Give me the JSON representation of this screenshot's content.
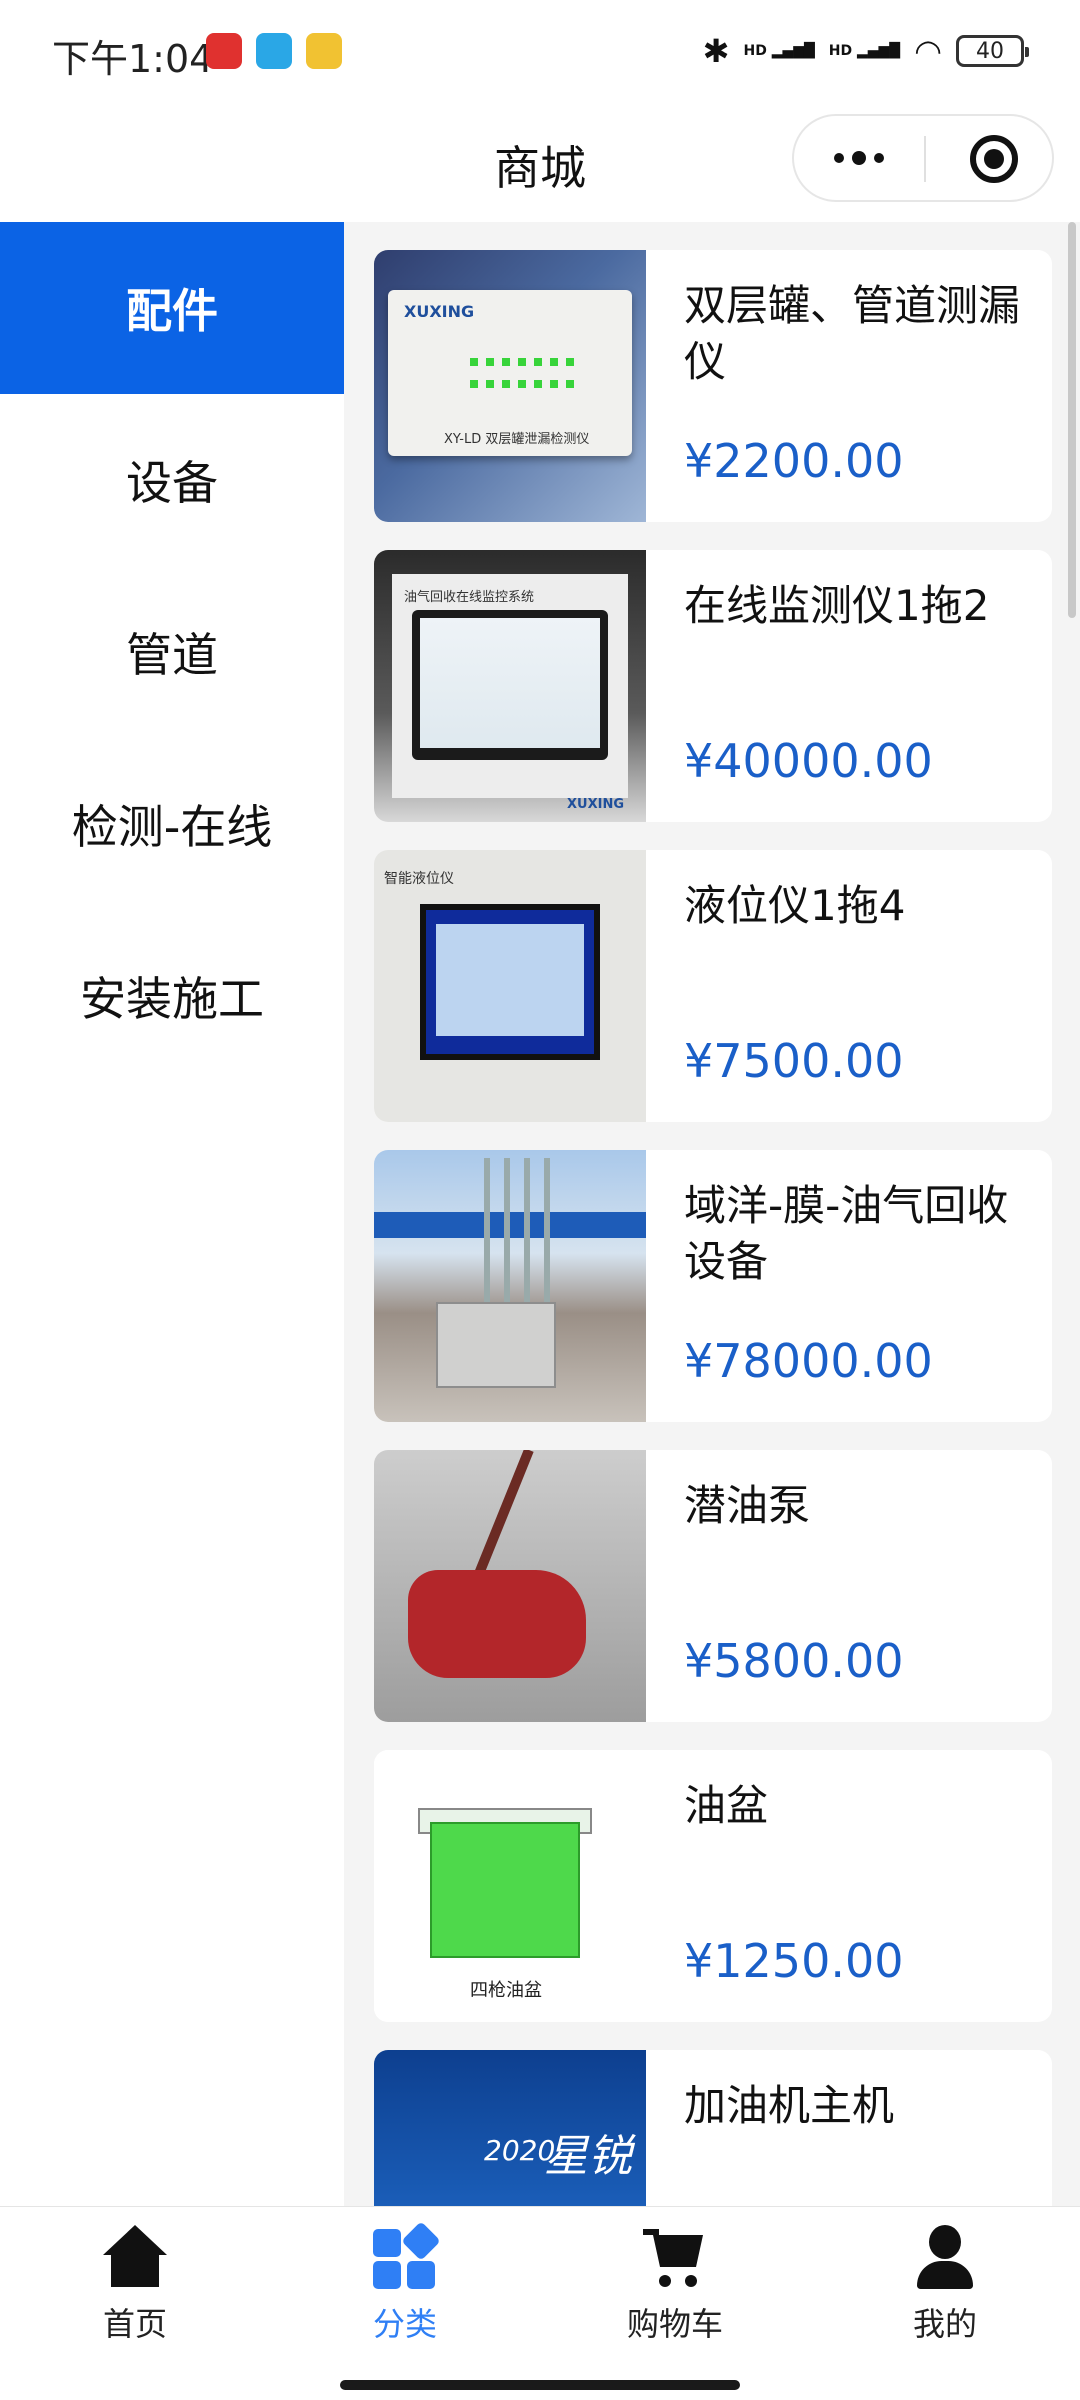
{
  "status_bar": {
    "time": "下午1:04",
    "battery": "40",
    "network_labels": [
      "HD",
      "HD"
    ]
  },
  "header": {
    "title": "商城"
  },
  "sidebar": {
    "items": [
      {
        "label": "配件",
        "active": true
      },
      {
        "label": "设备",
        "active": false
      },
      {
        "label": "管道",
        "active": false
      },
      {
        "label": "检测-在线",
        "active": false
      },
      {
        "label": "安装施工",
        "active": false
      }
    ]
  },
  "products": [
    {
      "name": "双层罐、管道测漏仪",
      "price": "¥2200.00",
      "image_text": [
        "XUXING",
        "XY-LD 双层罐泄漏检测仪"
      ]
    },
    {
      "name": "在线监测仪1拖2",
      "price": "¥40000.00",
      "image_text": [
        "油气回收在线监控系统",
        "XUXING"
      ]
    },
    {
      "name": "液位仪1拖4",
      "price": "¥7500.00",
      "image_text": [
        "智能液位仪"
      ]
    },
    {
      "name": "域洋-膜-油气回收设备",
      "price": "¥78000.00"
    },
    {
      "name": "潜油泵",
      "price": "¥5800.00"
    },
    {
      "name": "油盆",
      "price": "¥1250.00",
      "image_text": [
        "四枪油盆"
      ]
    },
    {
      "name": "加油机主机",
      "price": "",
      "image_text": [
        "2020",
        "星锐"
      ]
    }
  ],
  "tabbar": {
    "tabs": [
      {
        "label": "首页",
        "icon": "home-icon",
        "active": false
      },
      {
        "label": "分类",
        "icon": "category-icon",
        "active": true
      },
      {
        "label": "购物车",
        "icon": "cart-icon",
        "active": false
      },
      {
        "label": "我的",
        "icon": "user-icon",
        "active": false
      }
    ]
  },
  "colors": {
    "accent": "#0b63e5",
    "price": "#1a5fc8",
    "tab_active": "#2f7ff5"
  }
}
